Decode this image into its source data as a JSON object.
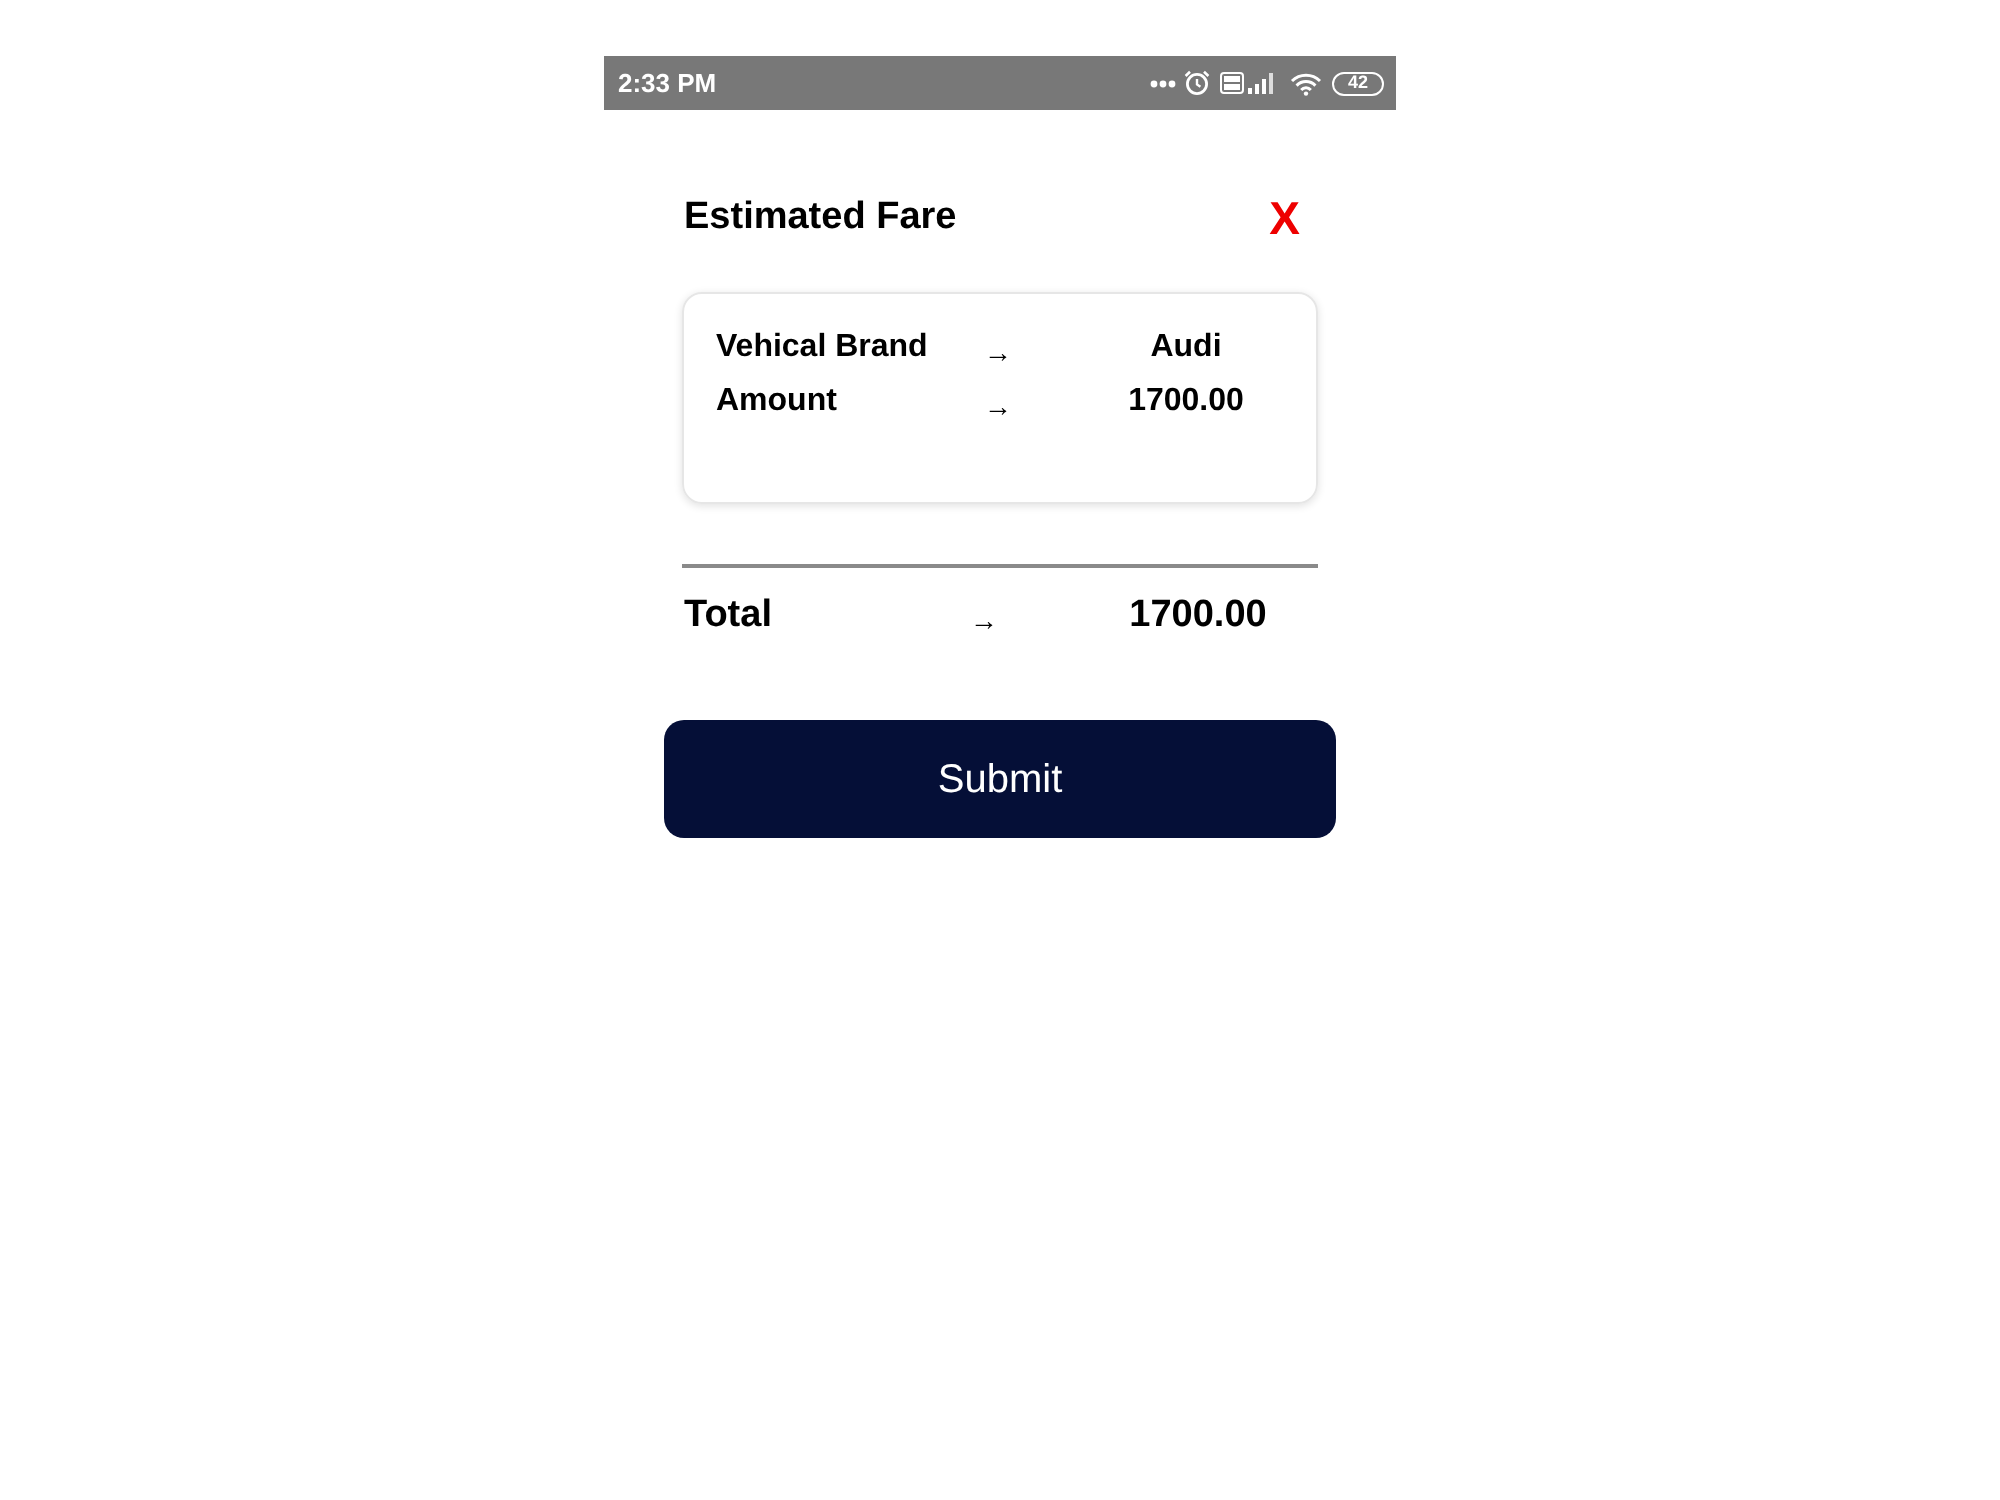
{
  "status_bar": {
    "time": "2:33 PM",
    "battery": "42"
  },
  "header": {
    "title": "Estimated Fare",
    "close": "X"
  },
  "details": [
    {
      "label": "Vehical Brand",
      "arrow": "→",
      "value": "Audi"
    },
    {
      "label": "Amount",
      "arrow": "→",
      "value": "1700.00"
    }
  ],
  "total": {
    "label": "Total",
    "arrow": "→",
    "value": "1700.00"
  },
  "submit": "Submit"
}
